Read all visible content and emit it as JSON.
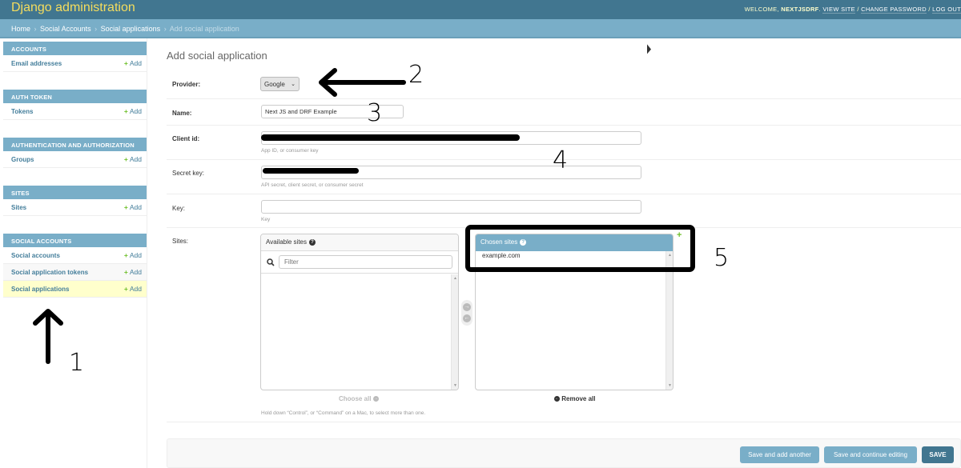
{
  "header": {
    "site_title": "Django administration",
    "welcome_prefix": "Welcome, ",
    "username": "NEXTJSDRF",
    "welcome_suffix": ". ",
    "view_site": "View site",
    "change_password": "Change password",
    "log_out": "Log out",
    "sep": " / "
  },
  "breadcrumbs": {
    "items": [
      "Home",
      "Social Accounts",
      "Social applications"
    ],
    "current": "Add social application",
    "sep": "›"
  },
  "sidebar": {
    "modules": [
      {
        "caption": "Accounts",
        "rows": [
          {
            "label": "Email addresses",
            "add": "Add",
            "selected": false
          }
        ]
      },
      {
        "caption": "Auth Token",
        "rows": [
          {
            "label": "Tokens",
            "add": "Add",
            "selected": false
          }
        ]
      },
      {
        "caption": "Authentication and Authorization",
        "rows": [
          {
            "label": "Groups",
            "add": "Add",
            "selected": false
          }
        ]
      },
      {
        "caption": "Sites",
        "rows": [
          {
            "label": "Sites",
            "add": "Add",
            "selected": false
          }
        ]
      },
      {
        "caption": "Social Accounts",
        "rows": [
          {
            "label": "Social accounts",
            "add": "Add",
            "selected": false
          },
          {
            "label": "Social application tokens",
            "add": "Add",
            "selected": false
          },
          {
            "label": "Social applications",
            "add": "Add",
            "selected": true
          }
        ]
      }
    ]
  },
  "form": {
    "title": "Add social application",
    "provider": {
      "label": "Provider:",
      "value": "Google"
    },
    "name": {
      "label": "Name:",
      "value": "Next JS and DRF Example"
    },
    "client_id": {
      "label": "Client id:",
      "value": "",
      "help": "App ID, or consumer key"
    },
    "secret_key": {
      "label": "Secret key:",
      "value": "",
      "help": "API secret, client secret, or consumer secret"
    },
    "key": {
      "label": "Key:",
      "value": "",
      "help": "Key"
    },
    "sites": {
      "label": "Sites:",
      "available_title": "Available sites",
      "filter_placeholder": "Filter",
      "chosen_title": "Chosen sites",
      "chosen_options": [
        "example.com"
      ],
      "choose_all": "Choose all",
      "remove_all": "Remove all",
      "help": "Hold down “Control”, or “Command” on a Mac, to select more than one."
    }
  },
  "submit": {
    "save_add_another": "Save and add another",
    "save_continue": "Save and continue editing",
    "save": "SAVE"
  },
  "annotations": [
    "1",
    "2",
    "3",
    "4",
    "5"
  ]
}
